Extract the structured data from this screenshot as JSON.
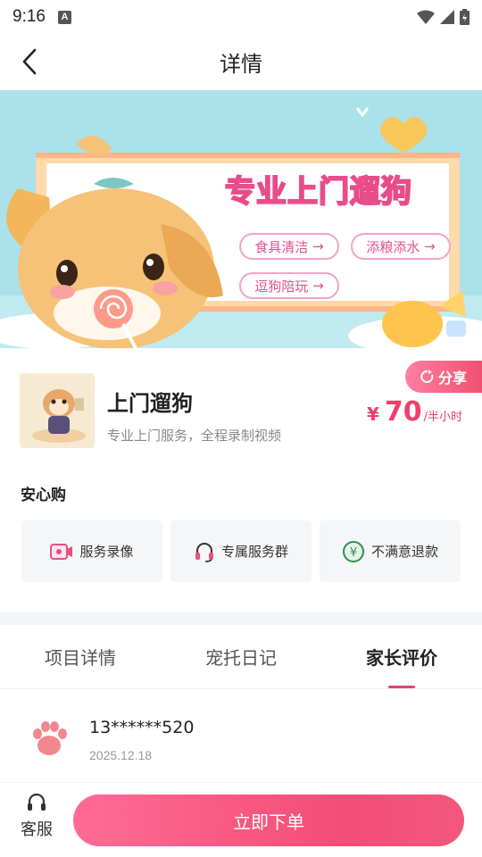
{
  "status_bar": {
    "time": "9:16",
    "notification": "A"
  },
  "nav": {
    "title": "详情"
  },
  "banner": {
    "headline": "专业上门遛狗",
    "tags": [
      "食具清洁",
      "添粮添水",
      "逗狗陪玩"
    ]
  },
  "product": {
    "name": "上门遛狗",
    "description": "专业上门服务，全程录制视频",
    "share_label": "分享",
    "price_currency": "¥",
    "price_value": "70",
    "price_unit": "/半小时"
  },
  "guarantee": {
    "title": "安心购",
    "items": [
      {
        "label": "服务录像",
        "icon": "video-icon"
      },
      {
        "label": "专属服务群",
        "icon": "headset-icon"
      },
      {
        "label": "不满意退款",
        "icon": "refund-icon"
      }
    ]
  },
  "tabs": [
    {
      "label": "项目详情",
      "active": false
    },
    {
      "label": "宠托日记",
      "active": false
    },
    {
      "label": "家长评价",
      "active": true
    }
  ],
  "review": {
    "user": "13******520",
    "date": "2025.12.18"
  },
  "bottom": {
    "service_label": "客服",
    "order_label": "立即下单"
  },
  "colors": {
    "accent": "#ef3f6b",
    "button": "#f34d76"
  }
}
